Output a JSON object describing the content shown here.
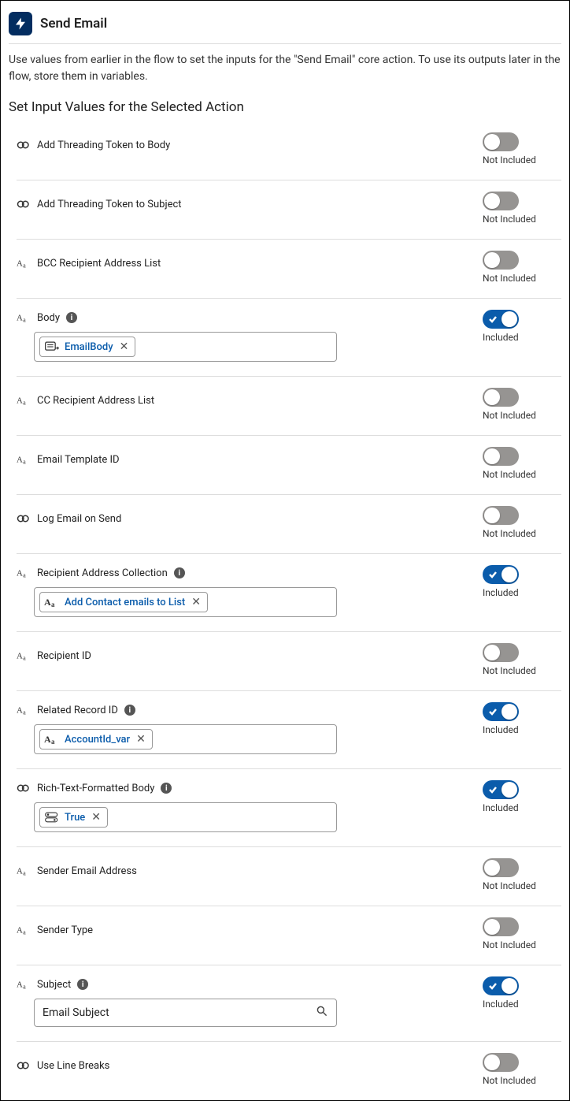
{
  "header": {
    "title": "Send Email",
    "description": "Use values from earlier in the flow to set the inputs for the \"Send Email\" core action. To use its outputs later in the flow, store them in variables."
  },
  "section_title": "Set Input Values for the Selected Action",
  "toggle_labels": {
    "on": "Included",
    "off": "Not Included"
  },
  "inputs": {
    "threading_body": {
      "label": "Add Threading Token to Body",
      "type": "boolean",
      "included": false,
      "has_info": false
    },
    "threading_subj": {
      "label": "Add Threading Token to Subject",
      "type": "boolean",
      "included": false,
      "has_info": false
    },
    "bcc": {
      "label": "BCC Recipient Address List",
      "type": "text",
      "included": false,
      "has_info": false
    },
    "body": {
      "label": "Body",
      "type": "text",
      "included": true,
      "has_info": true,
      "pill_icon": "template",
      "pill_text": "EmailBody"
    },
    "cc": {
      "label": "CC Recipient Address List",
      "type": "text",
      "included": false,
      "has_info": false
    },
    "template_id": {
      "label": "Email Template ID",
      "type": "text",
      "included": false,
      "has_info": false
    },
    "log_email": {
      "label": "Log Email on Send",
      "type": "boolean",
      "included": false,
      "has_info": false
    },
    "recipient_coll": {
      "label": "Recipient Address Collection",
      "type": "text",
      "included": true,
      "has_info": true,
      "pill_icon": "text",
      "pill_text": "Add Contact emails to List"
    },
    "recipient_id": {
      "label": "Recipient ID",
      "type": "text",
      "included": false,
      "has_info": false
    },
    "related_record": {
      "label": "Related Record ID",
      "type": "text",
      "included": true,
      "has_info": true,
      "pill_icon": "text",
      "pill_text": "AccountId_var"
    },
    "rich_body": {
      "label": "Rich-Text-Formatted Body",
      "type": "boolean",
      "included": true,
      "has_info": true,
      "pill_icon": "toggle",
      "pill_text": "True"
    },
    "sender_email": {
      "label": "Sender Email Address",
      "type": "text",
      "included": false,
      "has_info": false
    },
    "sender_type": {
      "label": "Sender Type",
      "type": "text",
      "included": false,
      "has_info": false
    },
    "subject": {
      "label": "Subject",
      "type": "text",
      "included": true,
      "has_info": true,
      "search_value": "Email Subject"
    },
    "line_breaks": {
      "label": "Use Line Breaks",
      "type": "boolean",
      "included": false,
      "has_info": false
    }
  }
}
